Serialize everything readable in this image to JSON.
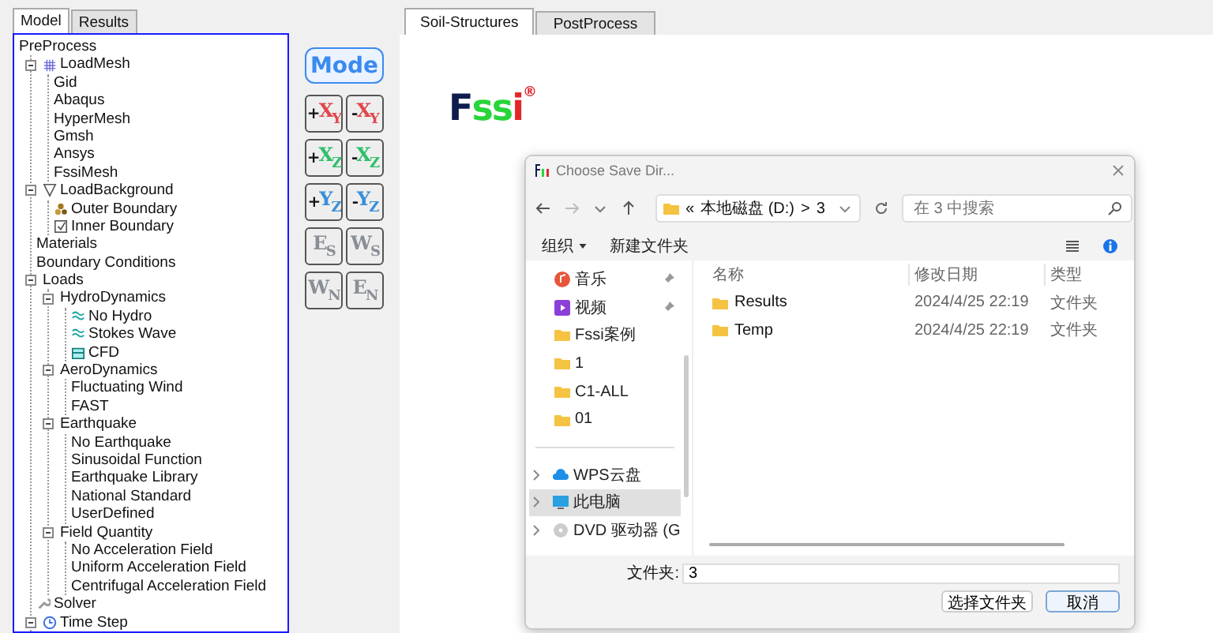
{
  "left_tabs": [
    {
      "label": "Model",
      "selected": true
    },
    {
      "label": "Results",
      "selected": false
    }
  ],
  "tree": [
    {
      "label": "PreProcess",
      "children": [
        {
          "label": "LoadMesh",
          "kind": "grid",
          "expanded": true,
          "children": [
            {
              "label": "Gid"
            },
            {
              "label": "Abaqus"
            },
            {
              "label": "HyperMesh"
            },
            {
              "label": "Gmsh"
            },
            {
              "label": "Ansys"
            },
            {
              "label": "FssiMesh"
            }
          ]
        },
        {
          "label": "LoadBackground",
          "kind": "funnel",
          "expanded": true,
          "children": [
            {
              "label": "Outer Boundary",
              "kind": "shapes"
            },
            {
              "label": "Inner Boundary",
              "kind": "checkbox"
            }
          ]
        },
        {
          "label": "Materials"
        },
        {
          "label": "Boundary Conditions"
        },
        {
          "label": "Loads",
          "expanded": true,
          "children": [
            {
              "label": "HydroDynamics",
              "expanded": true,
              "children": [
                {
                  "label": "No Hydro",
                  "kind": "wave"
                },
                {
                  "label": "Stokes Wave",
                  "kind": "wave"
                },
                {
                  "label": "CFD",
                  "kind": "tray"
                }
              ]
            },
            {
              "label": "AeroDynamics",
              "expanded": true,
              "children": [
                {
                  "label": "Fluctuating Wind"
                },
                {
                  "label": "FAST"
                }
              ]
            },
            {
              "label": "Earthquake",
              "expanded": true,
              "children": [
                {
                  "label": "No Earthquake"
                },
                {
                  "label": "Sinusoidal Function"
                },
                {
                  "label": "Earthquake Library"
                },
                {
                  "label": "National Standard"
                },
                {
                  "label": "UserDefined"
                }
              ]
            },
            {
              "label": "Field Quantity",
              "expanded": true,
              "children": [
                {
                  "label": "No Acceleration Field"
                },
                {
                  "label": "Uniform Acceleration Field"
                },
                {
                  "label": "Centrifugal Acceleration Field"
                }
              ]
            }
          ]
        },
        {
          "label": "Solver",
          "kind": "wrench"
        },
        {
          "label": "Time Step",
          "kind": "clock",
          "expanded": true
        }
      ]
    }
  ],
  "mode_button": {
    "label": "Mode"
  },
  "view_buttons": [
    {
      "sign": "+",
      "label": "X$_{Y}$",
      "color": "#e0474c"
    },
    {
      "sign": "-",
      "label": "X$_{Y}$",
      "color": "#e0474c"
    },
    {
      "sign": "+",
      "label": "X$_{Z}$",
      "color": "#2fbf6a"
    },
    {
      "sign": "-",
      "label": "X$_{Z}$",
      "color": "#2fbf6a"
    },
    {
      "sign": "+",
      "label": "Y$_{Z}$",
      "color": "#3a8fd8"
    },
    {
      "sign": "-",
      "label": "Y$_{Z}$",
      "color": "#3a8fd8"
    },
    {
      "label": "E$_{S}$",
      "color": "#8a8f96"
    },
    {
      "label": "W$_{S}$",
      "color": "#8a8f96"
    },
    {
      "label": "W$_{N}$",
      "color": "#8a8f96"
    },
    {
      "label": "E$_{N}$",
      "color": "#8a8f96"
    }
  ],
  "main_tabs": [
    {
      "label": "Soil-Structures",
      "selected": true
    },
    {
      "label": "PostProcess",
      "selected": false
    }
  ],
  "logo": {
    "parts": [
      {
        "text": "F",
        "color": "#0e1b4d"
      },
      {
        "text": "ss",
        "color": "#27d53a"
      },
      {
        "text": "i",
        "color": "#e3262b"
      }
    ],
    "mark": "®"
  },
  "dialog": {
    "title": "Choose Save Dir...",
    "path": {
      "overflow": "«",
      "segments": [
        {
          "label": "本地磁盘 (D:)"
        },
        {
          "label": "3"
        }
      ],
      "separator": ">"
    },
    "search": {
      "placeholder": "在 3 中搜索"
    },
    "toolbar": {
      "organize": "组织",
      "new_folder": "新建文件夹"
    },
    "nav_items": [
      {
        "label": "音乐",
        "kind": "music",
        "pinned": true,
        "selected": false
      },
      {
        "label": "视频",
        "kind": "video",
        "pinned": true,
        "selected": false
      },
      {
        "label": "Fssi案例",
        "kind": "folder",
        "pinned": false,
        "selected": false
      },
      {
        "label": "1",
        "kind": "folder",
        "pinned": false,
        "selected": false
      },
      {
        "label": "C1-ALL",
        "kind": "folder",
        "pinned": false,
        "selected": false
      },
      {
        "label": "01",
        "kind": "folder",
        "pinned": false,
        "selected": false
      },
      {
        "label": "WPS云盘",
        "kind": "cloud",
        "expandable": true,
        "pinned": false,
        "selected": false
      },
      {
        "label": "此电脑",
        "kind": "computer",
        "expandable": true,
        "pinned": false,
        "selected": true
      },
      {
        "label": "DVD 驱动器 (G",
        "kind": "disc",
        "expandable": true,
        "pinned": false,
        "selected": false
      }
    ],
    "columns": [
      "名称",
      "修改日期",
      "类型"
    ],
    "rows": [
      {
        "name": "Results",
        "date": "2024/4/25 22:19",
        "type": "文件夹"
      },
      {
        "name": "Temp",
        "date": "2024/4/25 22:19",
        "type": "文件夹"
      }
    ],
    "folder_label": "文件夹:",
    "folder_value": "3",
    "buttons": [
      {
        "label": "选择文件夹",
        "default": false
      },
      {
        "label": "取消",
        "default": true
      }
    ]
  }
}
